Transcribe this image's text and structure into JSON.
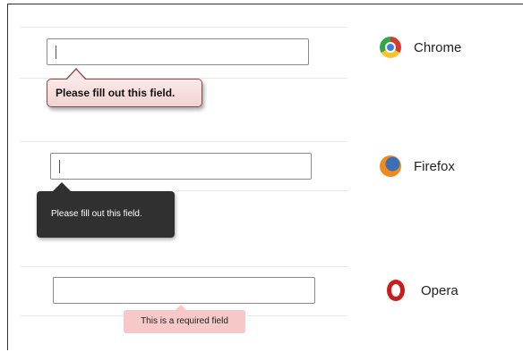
{
  "rows": [
    {
      "browser": "Chrome",
      "logo": "chrome-icon",
      "input_value": "",
      "message": "Please fill out this field."
    },
    {
      "browser": "Firefox",
      "logo": "firefox-icon",
      "input_value": "",
      "message": "Please fill out this field."
    },
    {
      "browser": "Opera",
      "logo": "opera-icon",
      "input_value": "",
      "message": "This is a required field"
    }
  ],
  "colors": {
    "chrome_bubble_bg": "#f2d2d2",
    "chrome_bubble_border": "#8b4a4a",
    "firefox_bubble_bg": "#303030",
    "opera_bubble_bg": "#f6c8c8"
  }
}
